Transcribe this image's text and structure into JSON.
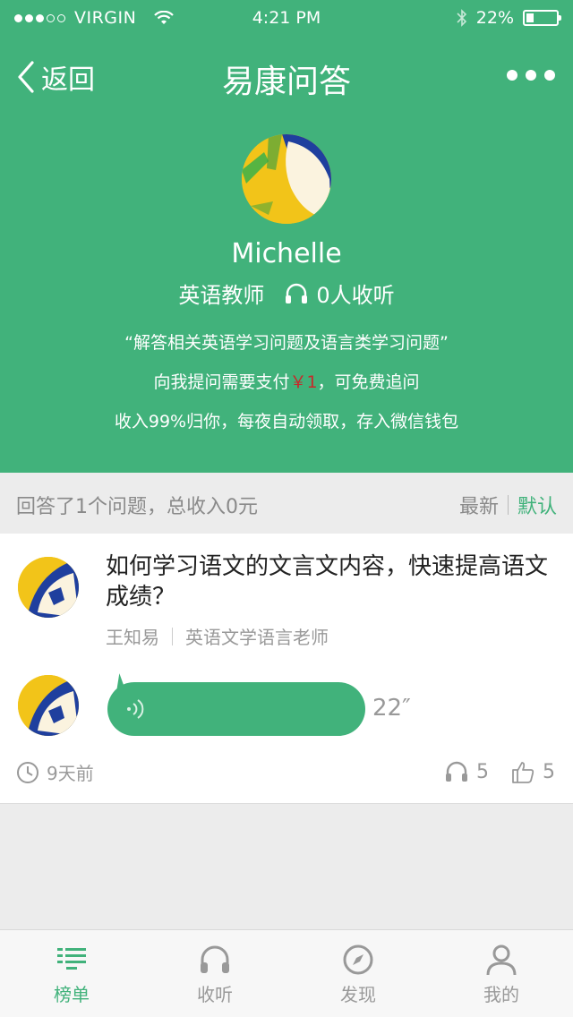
{
  "status_bar": {
    "carrier": "VIRGIN",
    "time": "4:21 PM",
    "battery": "22%",
    "battery_level": 0.22
  },
  "nav": {
    "back_label": "返回",
    "title": "易康问答"
  },
  "profile": {
    "name": "Michelle",
    "role": "英语教师",
    "listeners": "0人收听",
    "desc_line1": "“解答相关英语学习问题及语言类学习问题”",
    "desc_line2_pre": "向我提问需要支付",
    "desc_line2_price": "￥1",
    "desc_line2_post": "，可免费追问",
    "desc_line3": "收入99%归你，每夜自动领取，存入微信钱包"
  },
  "answers_bar": {
    "summary": "回答了1个问题，总收入0元",
    "sort_latest": "最新",
    "sort_default": "默认"
  },
  "question": {
    "text": "如何学习语文的文言文内容，快速提高语文成绩？",
    "asker": "王知易",
    "asker_title": "英语文学语言老师",
    "duration": "22″",
    "time_ago": "9天前",
    "listens": "5",
    "likes": "5"
  },
  "tabs": [
    {
      "label": "榜单"
    },
    {
      "label": "收听"
    },
    {
      "label": "发现"
    },
    {
      "label": "我的"
    }
  ],
  "colors": {
    "brand_green": "#41b27b",
    "price_red": "#c62b2b"
  }
}
